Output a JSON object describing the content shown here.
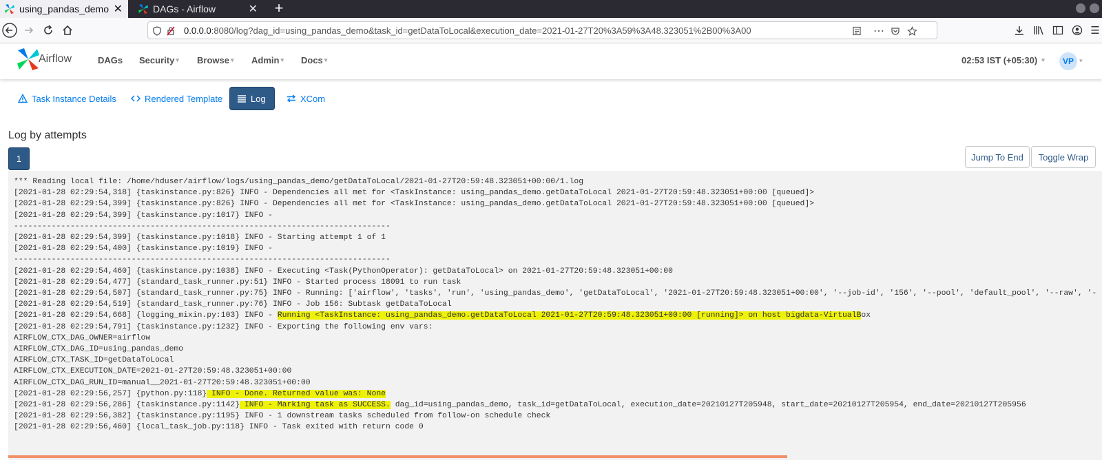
{
  "browser": {
    "tabs": [
      {
        "label": "using_pandas_demo - Ai",
        "active": true
      },
      {
        "label": "DAGs - Airflow",
        "active": false
      }
    ],
    "url": {
      "host": "0.0.0.0",
      "rest": ":8080/log?dag_id=using_pandas_demo&task_id=getDataToLocal&execution_date=2021-01-27T20%3A59%3A48.323051%2B00%3A00"
    }
  },
  "header": {
    "brand": "Airflow",
    "menu": [
      "DAGs",
      "Security",
      "Browse",
      "Admin",
      "Docs"
    ],
    "clock": "02:53 IST (+05:30)",
    "avatar": "VP"
  },
  "subtabs": [
    {
      "label": "Task Instance Details",
      "icon": "warning-triangle-icon"
    },
    {
      "label": "Rendered Template",
      "icon": "code-icon"
    },
    {
      "label": "Log",
      "icon": "list-icon",
      "active": true
    },
    {
      "label": "XCom",
      "icon": "swap-arrows-icon"
    }
  ],
  "log_section": {
    "title": "Log by attempts",
    "attempt": "1",
    "jump_button": "Jump To End",
    "wrap_button": "Toggle Wrap"
  },
  "log_lines": [
    {
      "pre": "*** Reading local file: /home/hduser/airflow/logs/using_pandas_demo/getDataToLocal/2021-01-27T20:59:48.323051+00:00/1.log",
      "hl": "",
      "post": ""
    },
    {
      "pre": "[2021-01-28 02:29:54,318] {taskinstance.py:826} INFO - Dependencies all met for <TaskInstance: using_pandas_demo.getDataToLocal 2021-01-27T20:59:48.323051+00:00 [queued]>",
      "hl": "",
      "post": ""
    },
    {
      "pre": "[2021-01-28 02:29:54,399] {taskinstance.py:826} INFO - Dependencies all met for <TaskInstance: using_pandas_demo.getDataToLocal 2021-01-27T20:59:48.323051+00:00 [queued]>",
      "hl": "",
      "post": ""
    },
    {
      "pre": "[2021-01-28 02:29:54,399] {taskinstance.py:1017} INFO -",
      "hl": "",
      "post": ""
    },
    {
      "pre": "--------------------------------------------------------------------------------",
      "hl": "",
      "post": ""
    },
    {
      "pre": "[2021-01-28 02:29:54,399] {taskinstance.py:1018} INFO - Starting attempt 1 of 1",
      "hl": "",
      "post": ""
    },
    {
      "pre": "[2021-01-28 02:29:54,400] {taskinstance.py:1019} INFO -",
      "hl": "",
      "post": ""
    },
    {
      "pre": "--------------------------------------------------------------------------------",
      "hl": "",
      "post": ""
    },
    {
      "pre": "[2021-01-28 02:29:54,460] {taskinstance.py:1038} INFO - Executing <Task(PythonOperator): getDataToLocal> on 2021-01-27T20:59:48.323051+00:00",
      "hl": "",
      "post": ""
    },
    {
      "pre": "[2021-01-28 02:29:54,477] {standard_task_runner.py:51} INFO - Started process 18091 to run task",
      "hl": "",
      "post": ""
    },
    {
      "pre": "[2021-01-28 02:29:54,507] {standard_task_runner.py:75} INFO - Running: ['airflow', 'tasks', 'run', 'using_pandas_demo', 'getDataToLocal', '2021-01-27T20:59:48.323051+00:00', '--job-id', '156', '--pool', 'default_pool', '--raw', '-",
      "hl": "",
      "post": ""
    },
    {
      "pre": "[2021-01-28 02:29:54,519] {standard_task_runner.py:76} INFO - Job 156: Subtask getDataToLocal",
      "hl": "",
      "post": ""
    },
    {
      "pre": "[2021-01-28 02:29:54,668] {logging_mixin.py:103} INFO - ",
      "hl": "Running <TaskInstance: using_pandas_demo.getDataToLocal 2021-01-27T20:59:48.323051+00:00 [running]> on host bigdata-VirtualB",
      "post": "ox"
    },
    {
      "pre": "[2021-01-28 02:29:54,791] {taskinstance.py:1232} INFO - Exporting the following env vars:",
      "hl": "",
      "post": ""
    },
    {
      "pre": "AIRFLOW_CTX_DAG_OWNER=airflow",
      "hl": "",
      "post": ""
    },
    {
      "pre": "AIRFLOW_CTX_DAG_ID=using_pandas_demo",
      "hl": "",
      "post": ""
    },
    {
      "pre": "AIRFLOW_CTX_TASK_ID=getDataToLocal",
      "hl": "",
      "post": ""
    },
    {
      "pre": "AIRFLOW_CTX_EXECUTION_DATE=2021-01-27T20:59:48.323051+00:00",
      "hl": "",
      "post": ""
    },
    {
      "pre": "AIRFLOW_CTX_DAG_RUN_ID=manual__2021-01-27T20:59:48.323051+00:00",
      "hl": "",
      "post": ""
    },
    {
      "pre": "[2021-01-28 02:29:56,257] {python.py:118}",
      "hl": " INFO - Done. Returned value was: None",
      "post": ""
    },
    {
      "pre": "[2021-01-28 02:29:56,286] {taskinstance.py:1142}",
      "hl": " INFO - Marking task as SUCCESS.",
      "post": " dag_id=using_pandas_demo, task_id=getDataToLocal, execution_date=20210127T205948, start_date=20210127T205954, end_date=20210127T205956"
    },
    {
      "pre": "[2021-01-28 02:29:56,382] {taskinstance.py:1195} INFO - 1 downstream tasks scheduled from follow-on schedule check",
      "hl": "",
      "post": ""
    },
    {
      "pre": "[2021-01-28 02:29:56,460] {local_task_job.py:118} INFO - Task exited with return code 0",
      "hl": "",
      "post": ""
    }
  ],
  "colors": {
    "accent": "#017cee",
    "active_tab": "#2e5a88",
    "highlight": "#eef108",
    "progress": "#f0906a",
    "log_bg": "#f2f2f2"
  }
}
